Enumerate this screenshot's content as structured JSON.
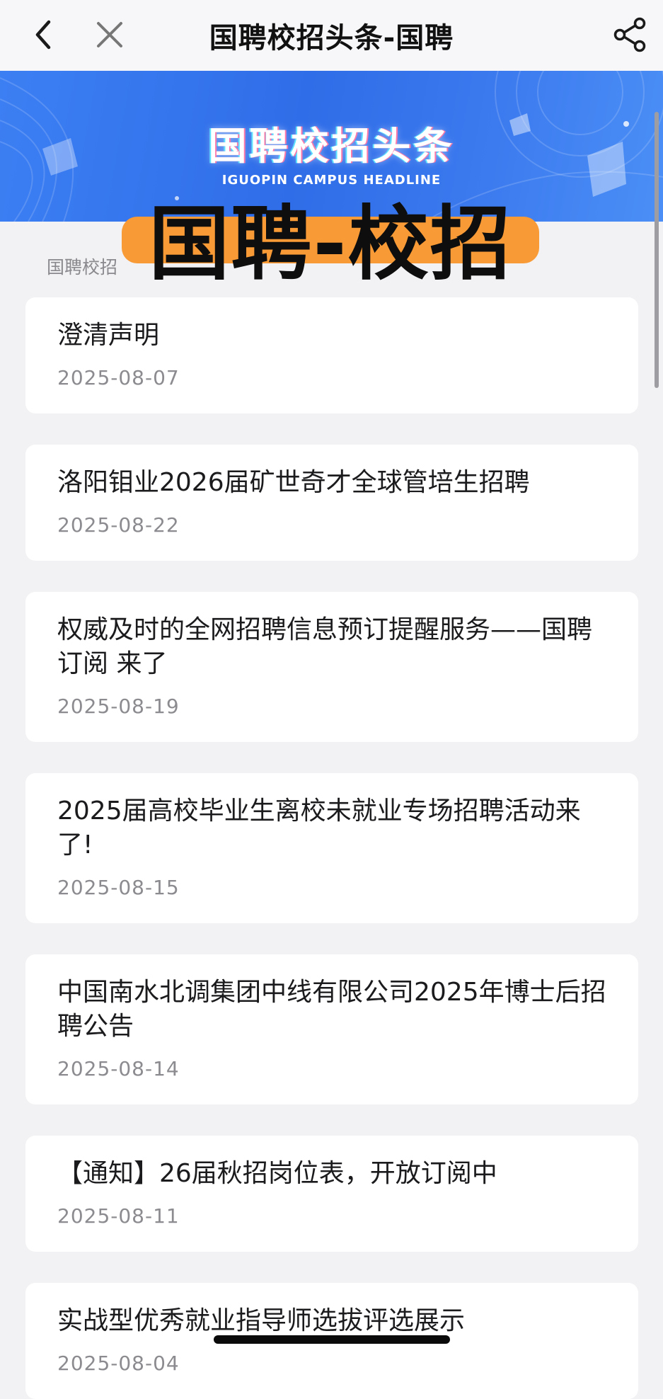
{
  "nav": {
    "title": "国聘校招头条-国聘",
    "back_icon": "chevron-left-icon",
    "close_icon": "close-icon",
    "share_icon": "share-icon"
  },
  "banner": {
    "title": "国聘校招头条",
    "subtitle": "IGUOPIN CAMPUS HEADLINE"
  },
  "overlay": {
    "text": "国聘-校招",
    "highlight_color": "#f89a35"
  },
  "section": {
    "label": "国聘校招"
  },
  "articles": [
    {
      "title": "澄清声明",
      "date": "2025-08-07"
    },
    {
      "title": "洛阳钼业2026届矿世奇才全球管培生招聘",
      "date": "2025-08-22"
    },
    {
      "title": "权威及时的全网招聘信息预订提醒服务——国聘订阅 来了",
      "date": "2025-08-19"
    },
    {
      "title": "2025届高校毕业生离校未就业专场招聘活动来了!",
      "date": "2025-08-15"
    },
    {
      "title": "中国南水北调集团中线有限公司2025年博士后招聘公告",
      "date": "2025-08-14"
    },
    {
      "title": "【通知】26届秋招岗位表，开放订阅中",
      "date": "2025-08-11"
    },
    {
      "title": "实战型优秀就业指导师选拔评选展示",
      "date": "2025-08-04"
    }
  ],
  "colors": {
    "banner_blue": "#2f6de8",
    "page_bg": "#f2f2f4"
  }
}
